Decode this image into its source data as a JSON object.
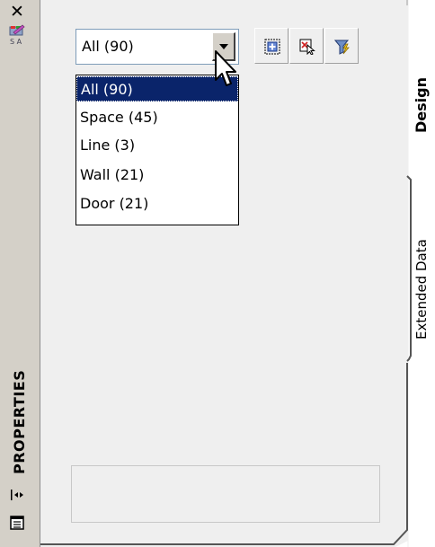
{
  "palette": {
    "title": "PROPERTIES",
    "close_glyph": "✕"
  },
  "filter_combo": {
    "value": "All (90)"
  },
  "filter_list": {
    "items": [
      {
        "label": "All (90)",
        "selected": true
      },
      {
        "label": "Space (45)",
        "selected": false
      },
      {
        "label": "Line (3)",
        "selected": false
      },
      {
        "label": "Wall (21)",
        "selected": false
      },
      {
        "label": "Door (21)",
        "selected": false
      }
    ]
  },
  "toolbar": {
    "buttons": [
      {
        "icon": "toggle-pickadd-icon"
      },
      {
        "icon": "select-objects-icon"
      },
      {
        "icon": "quick-select-icon"
      }
    ]
  },
  "tabs": {
    "design": "Design",
    "extended_data": "Extended Data"
  },
  "colors": {
    "selection": "#0a246a",
    "panel_bg": "#efefef",
    "strip_bg": "#d4d0c8"
  }
}
